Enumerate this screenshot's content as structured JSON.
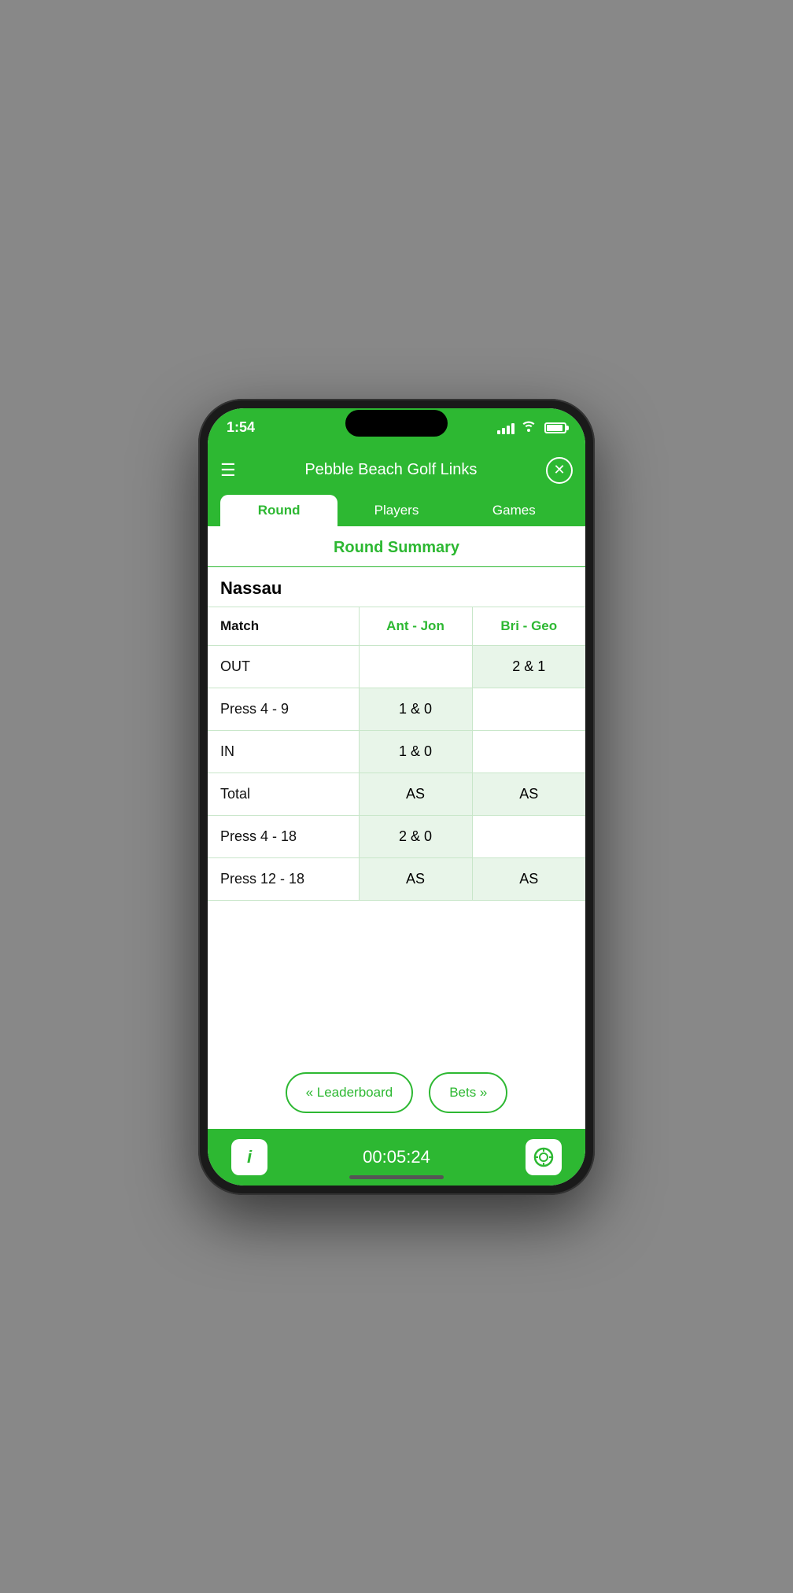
{
  "status": {
    "time": "1:54",
    "timer": "00:05:24"
  },
  "header": {
    "title": "Pebble Beach Golf Links",
    "menu_icon": "☰",
    "close_icon": "✕"
  },
  "tabs": [
    {
      "label": "Round",
      "active": true
    },
    {
      "label": "Players",
      "active": false
    },
    {
      "label": "Games",
      "active": false
    }
  ],
  "round_summary": {
    "title": "Round Summary",
    "section_name": "Nassau",
    "columns": {
      "match": "Match",
      "team1": "Ant - Jon",
      "team2": "Bri - Geo"
    },
    "rows": [
      {
        "match": "OUT",
        "team1": "",
        "team2": "2 & 1",
        "t1_highlight": false,
        "t2_highlight": true
      },
      {
        "match": "Press 4 - 9",
        "team1": "1 & 0",
        "team2": "",
        "t1_highlight": true,
        "t2_highlight": false
      },
      {
        "match": "IN",
        "team1": "1 & 0",
        "team2": "",
        "t1_highlight": true,
        "t2_highlight": false
      },
      {
        "match": "Total",
        "team1": "AS",
        "team2": "AS",
        "t1_highlight": true,
        "t2_highlight": true
      },
      {
        "match": "Press 4 - 18",
        "team1": "2 & 0",
        "team2": "",
        "t1_highlight": true,
        "t2_highlight": false
      },
      {
        "match": "Press 12 - 18",
        "team1": "AS",
        "team2": "AS",
        "t1_highlight": true,
        "t2_highlight": true
      }
    ]
  },
  "bottom_nav": {
    "leaderboard_label": "« Leaderboard",
    "bets_label": "Bets »"
  },
  "bottom_bar": {
    "info_icon": "i",
    "target_icon": "⊕"
  }
}
